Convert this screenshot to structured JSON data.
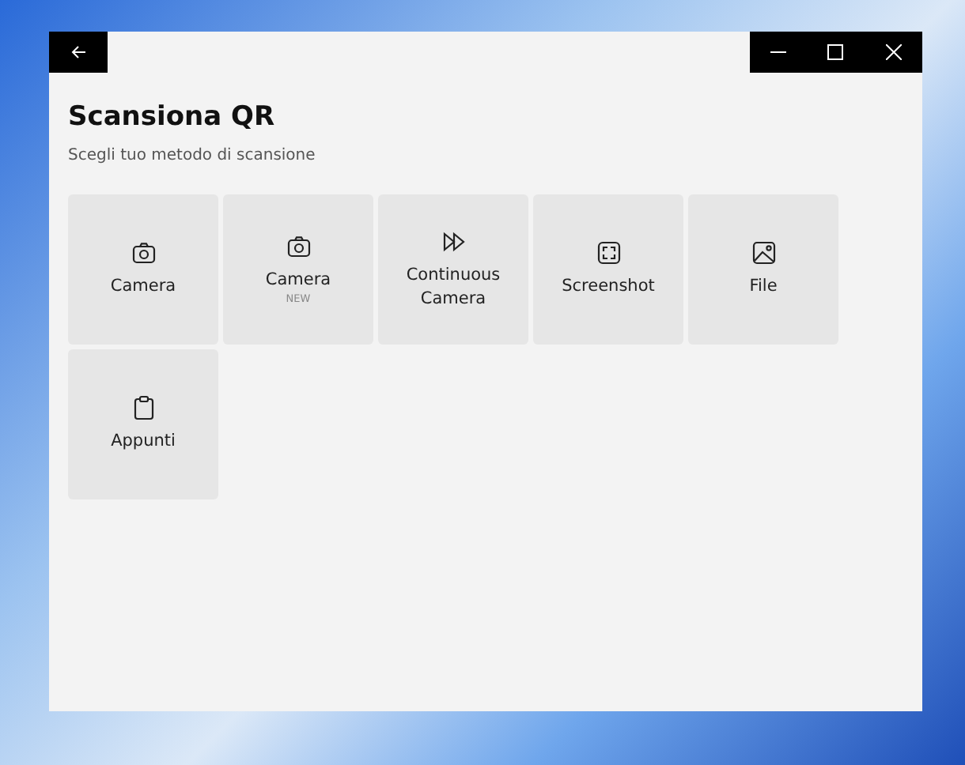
{
  "window": {
    "title": "Scansiona QR",
    "subtitle": "Scegli tuo metodo di scansione"
  },
  "tiles": [
    {
      "label": "Camera",
      "kind": "camera"
    },
    {
      "label": "Camera",
      "kind": "camera",
      "badge": "NEW"
    },
    {
      "label": "Continuous Camera",
      "kind": "continuous"
    },
    {
      "label": "Screenshot",
      "kind": "screenshot"
    },
    {
      "label": "File",
      "kind": "file"
    },
    {
      "label": "Appunti",
      "kind": "clipboard"
    }
  ]
}
